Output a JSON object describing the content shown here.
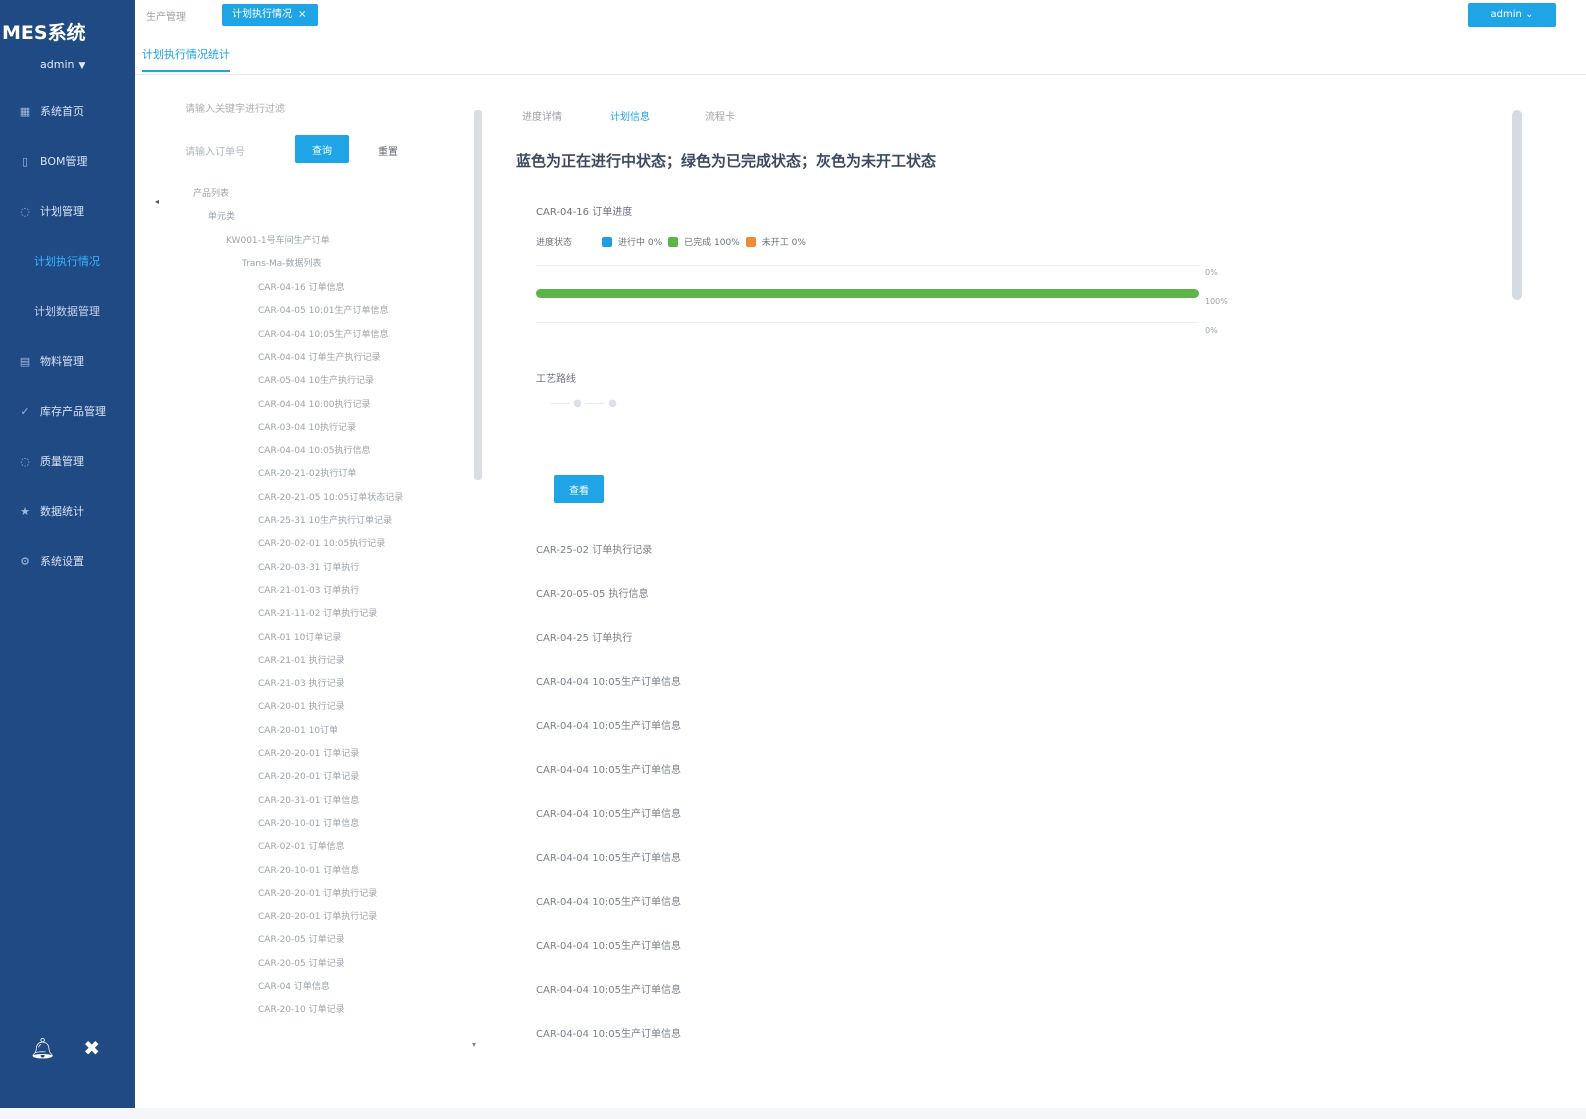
{
  "sidebar": {
    "brand": "MES系统",
    "user": "admin",
    "items": [
      {
        "label": "系统首页",
        "icon": "grid-icon"
      },
      {
        "label": "BOM管理",
        "icon": "document-icon"
      },
      {
        "label": "计划管理",
        "icon": "circle-icon"
      },
      {
        "label": "计划执行情况",
        "icon": ""
      },
      {
        "label": "计划数据管理",
        "icon": ""
      },
      {
        "label": "物料管理",
        "icon": "table-icon"
      },
      {
        "label": "库存产品管理",
        "icon": "check-icon"
      },
      {
        "label": "质量管理",
        "icon": "circle-icon"
      },
      {
        "label": "数据统计",
        "icon": "star-icon"
      },
      {
        "label": "系统设置",
        "icon": "gear-icon"
      }
    ]
  },
  "tabs": {
    "home": "生产管理",
    "active": "计划执行情况",
    "close": "×"
  },
  "top_right_button": "admin",
  "subtitle": "计划执行情况统计",
  "tree_panel": {
    "search_hint": "请输入关键字进行过滤",
    "input_placeholder": "请输入订单号",
    "search_button": "查询",
    "reset_button": "重置",
    "root": "产品列表",
    "level1": "单元类",
    "level2": "KW001-1号车间生产订单",
    "level3": "Trans-Ma-数据列表",
    "items": [
      "CAR-04-16 订单信息",
      "CAR-04-05 10:01生产订单信息",
      "CAR-04-04 10:05生产订单信息",
      "CAR-04-04 订单生产执行记录",
      "CAR-05-04 10生产执行记录",
      "CAR-04-04 10:00执行记录",
      "CAR-03-04 10执行记录",
      "CAR-04-04 10:05执行信息",
      "CAR-20-21-02执行订单",
      "CAR-20-21-05 10:05订单状态记录",
      "CAR-25-31 10生产执行订单记录",
      "CAR-20-02-01 10:05执行记录",
      "CAR-20-03-31 订单执行",
      "CAR-21-01-03 订单执行",
      "CAR-21-11-02 订单执行记录",
      "CAR-01 10订单记录",
      "CAR-21-01 执行记录",
      "CAR-21-03 执行记录",
      "CAR-20-01 执行记录",
      "CAR-20-01 10订单",
      "CAR-20-20-01 订单记录",
      "CAR-20-20-01 订单记录",
      "CAR-20-31-01 订单信息",
      "CAR-20-10-01 订单信息",
      "CAR-02-01 订单信息",
      "CAR-20-10-01 订单信息",
      "CAR-20-20-01 订单执行记录",
      "CAR-20-20-01 订单执行记录",
      "CAR-20-05 订单记录",
      "CAR-20-05 订单记录",
      "CAR-04 订单信息",
      "CAR-20-10 订单记录"
    ]
  },
  "right_panel": {
    "tabs": [
      "进度详情",
      "计划信息",
      "流程卡"
    ],
    "legend_title": "蓝色为正在进行中状态；绿色为已完成状态；灰色为未开工状态",
    "order_label": "CAR-04-16 订单进度",
    "progress_label": "进度状态",
    "legend_items": [
      {
        "label": "进行中 0%",
        "color": "#1f9fe0"
      },
      {
        "label": "已完成 100%",
        "color": "#5cb548"
      },
      {
        "label": "未开工 0%",
        "color": "#ef8a36"
      }
    ],
    "bar_progress": 1.0,
    "axis_labels": [
      "0%",
      "100%",
      "0%"
    ],
    "process_label": "工艺路线",
    "process_faint": "——  ●  ——  ●",
    "button": "查看",
    "order_list": [
      "CAR-25-02 订单执行记录",
      "CAR-20-05-05 执行信息",
      "CAR-04-25 订单执行",
      "CAR-04-04 10:05生产订单信息",
      "CAR-04-04 10:05生产订单信息",
      "CAR-04-04 10:05生产订单信息",
      "CAR-04-04 10:05生产订单信息",
      "CAR-04-04 10:05生产订单信息",
      "CAR-04-04 10:05生产订单信息",
      "CAR-04-04 10:05生产订单信息",
      "CAR-04-04 10:05生产订单信息",
      "CAR-04-04 10:05生产订单信息"
    ]
  },
  "bottom_icons": [
    "bell-icon",
    "close-icon"
  ]
}
